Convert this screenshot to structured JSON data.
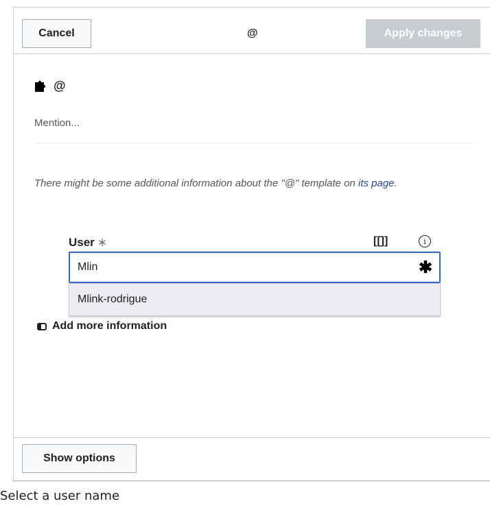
{
  "dialog": {
    "cancel_label": "Cancel",
    "title": "@",
    "apply_label": "Apply changes"
  },
  "template": {
    "icon": "puzzle-icon",
    "name": "@",
    "description": "Mention...",
    "note_prefix": "There might be some additional information about the \"@\" template on ",
    "note_link": "its page",
    "note_suffix": "."
  },
  "parameter": {
    "label": "User",
    "required_marker": "∗",
    "wikilink_label": "[[]]",
    "info_icon": "i",
    "input_value": "Mlin",
    "input_required_icon": "✱",
    "suggestions": [
      "Mlink-rodrigue"
    ]
  },
  "add_more": {
    "label": "Add more information",
    "icon": "checkbox-icon"
  },
  "footer": {
    "show_options_label": "Show options"
  },
  "caption": "Select a user name",
  "colors": {
    "accent": "#3366cc",
    "disabled_button": "#c8ccd1",
    "link": "#2a4b8d"
  }
}
